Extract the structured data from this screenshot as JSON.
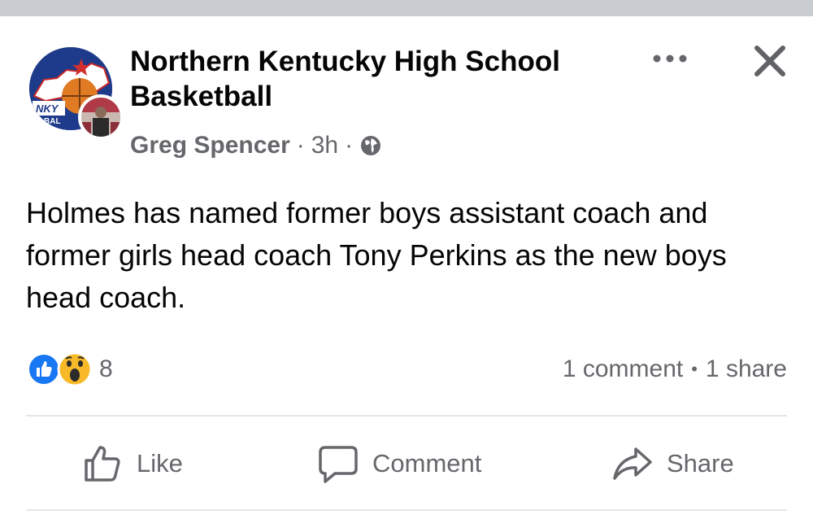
{
  "post": {
    "group_name": "Northern Kentucky High School Basketball",
    "author": "Greg Spencer",
    "separator": "·",
    "time": "3h",
    "body": "Holmes has named former boys assistant coach and former girls head coach Tony Perkins as the new boys head coach.",
    "avatar_text": "NKY",
    "avatar_subtext": "BAL",
    "icons": {
      "more": "more-options-icon",
      "close": "close-icon",
      "audience": "globe-icon",
      "like_reaction": "like-reaction-icon",
      "wow_reaction": "wow-reaction-icon"
    }
  },
  "stats": {
    "reaction_count": "8",
    "comments": "1 comment",
    "dot": "•",
    "shares": "1 share"
  },
  "actions": {
    "like_label": "Like",
    "comment_label": "Comment",
    "share_label": "Share"
  },
  "colors": {
    "text_primary": "#050505",
    "text_secondary": "#65676b",
    "like_blue": "#1877f2",
    "wow_yellow": "#f7b928",
    "divider": "#e4e6eb"
  }
}
